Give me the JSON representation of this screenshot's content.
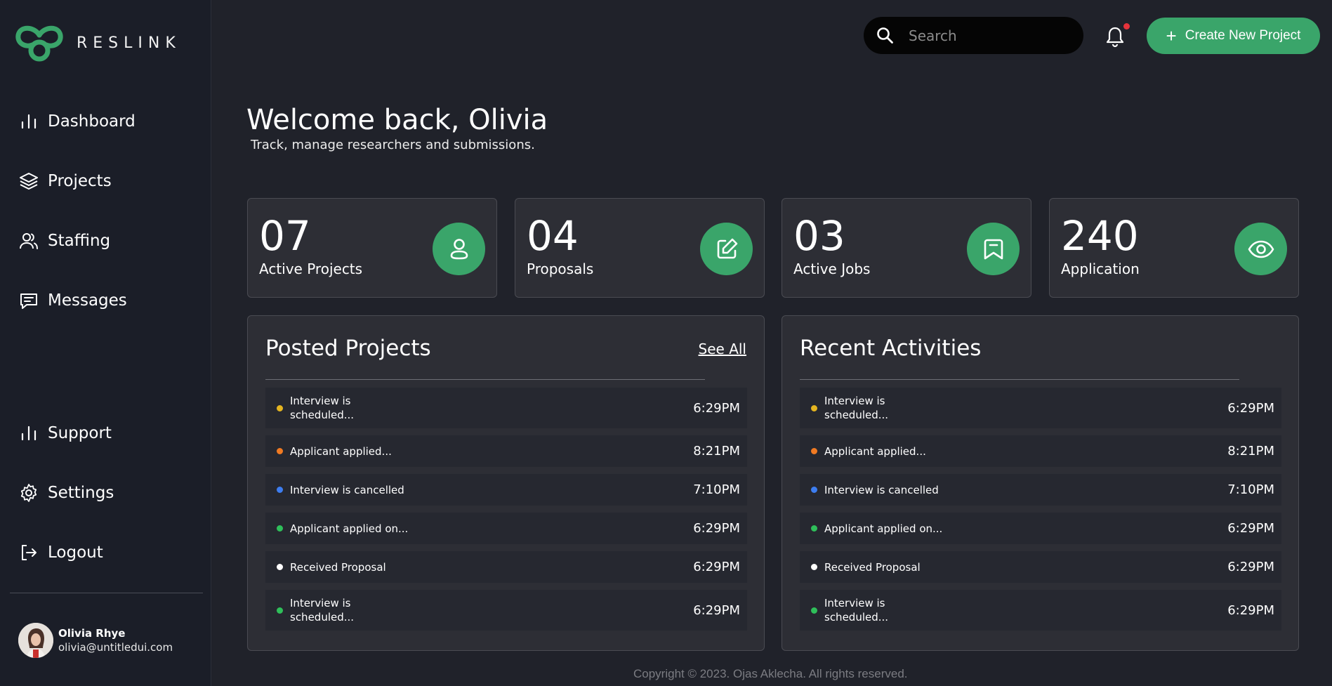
{
  "app": {
    "name": "RESLINK",
    "brand_color": "#3aa56a"
  },
  "sidebar": {
    "items": [
      {
        "label": "Dashboard",
        "icon": "bar-chart-icon"
      },
      {
        "label": "Projects",
        "icon": "layers-icon"
      },
      {
        "label": "Staffing",
        "icon": "users-icon"
      },
      {
        "label": "Messages",
        "icon": "message-icon"
      }
    ],
    "bottom_items": [
      {
        "label": "Support",
        "icon": "bar-chart-icon"
      },
      {
        "label": "Settings",
        "icon": "gear-icon"
      },
      {
        "label": "Logout",
        "icon": "logout-icon"
      }
    ],
    "user": {
      "name": "Olivia Rhye",
      "email": "olivia@untitledui.com"
    }
  },
  "header": {
    "search_placeholder": "Search",
    "create_label": "Create New Project",
    "notification_dot_color": "#e5333b"
  },
  "main": {
    "welcome": "Welcome back, Olivia",
    "subtitle": "Track, manage researchers and submissions.",
    "stats": [
      {
        "value": "07",
        "label": "Active Projects",
        "icon": "user-icon"
      },
      {
        "value": "04",
        "label": "Proposals",
        "icon": "edit-icon"
      },
      {
        "value": "03",
        "label": "Active Jobs",
        "icon": "bookmark-icon"
      },
      {
        "value": "240",
        "label": "Application",
        "icon": "eye-icon"
      }
    ],
    "posted_projects": {
      "title": "Posted Projects",
      "see_all": "See All",
      "rows": [
        {
          "text": "Interview is scheduled...",
          "time": "6:29PM",
          "dot": "#e5b520"
        },
        {
          "text": "Applicant applied...",
          "time": "8:21PM",
          "dot": "#f07a22"
        },
        {
          "text": "Interview is cancelled",
          "time": "7:10PM",
          "dot": "#3d7df0"
        },
        {
          "text": "Applicant applied on...",
          "time": "6:29PM",
          "dot": "#2fbf5a"
        },
        {
          "text": "Received Proposal",
          "time": "6:29PM",
          "dot": "#ffffff"
        },
        {
          "text": "Interview is scheduled...",
          "time": "6:29PM",
          "dot": "#2fbf5a"
        }
      ]
    },
    "recent_activities": {
      "title": "Recent Activities",
      "rows": [
        {
          "text": "Interview is scheduled...",
          "time": "6:29PM",
          "dot": "#e5b520"
        },
        {
          "text": "Applicant applied...",
          "time": "8:21PM",
          "dot": "#f07a22"
        },
        {
          "text": "Interview is cancelled",
          "time": "7:10PM",
          "dot": "#3d7df0"
        },
        {
          "text": "Applicant applied on...",
          "time": "6:29PM",
          "dot": "#2fbf5a"
        },
        {
          "text": "Received Proposal",
          "time": "6:29PM",
          "dot": "#ffffff"
        },
        {
          "text": "Interview is scheduled...",
          "time": "6:29PM",
          "dot": "#2fbf5a"
        }
      ]
    }
  },
  "footer": {
    "copyright": "Copyright © 2023. Ojas Aklecha. All rights reserved."
  }
}
